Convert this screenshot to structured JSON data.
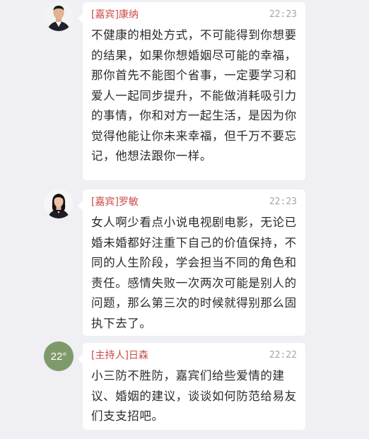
{
  "messages": [
    {
      "sender": "[嘉宾]康纳",
      "time": "22:23",
      "avatar": "male-guest-photo",
      "text": "不健康的相处方式，不可能得到你想要的结果，如果你想婚姻尽可能的幸福，那你首先不能图个省事，一定要学习和爱人一起同步提升，不能做消耗吸引力的事情，你和对方一起生活，是因为你觉得他能让你未来幸福，但千万不要忘记，他想法跟你一样。"
    },
    {
      "sender": "[嘉宾]罗敏",
      "time": "22:23",
      "avatar": "female-guest-photo",
      "text": "女人啊少看点小说电视剧电影，无论已婚未婚都好注重下自己的价值保持，不同的人生阶段，学会担当不同的角色和责任。感情失败一次两次可能是别人的问题，那么第三次的时候就得别那么固执下去了。"
    },
    {
      "sender": "[主持人]日森",
      "time": "22:22",
      "avatar_text": "22°",
      "text": "小三防不胜防，嘉宾们给些爱情的建议、婚姻的建议，谈谈如何防范给易友们支支招吧。"
    }
  ],
  "colors": {
    "background": "#efeff4",
    "bubble": "#ffffff",
    "sender_name": "#cc4a4a",
    "time": "#a6a6a6",
    "text": "#2b2b2b",
    "host_avatar": "#7f9a6a"
  }
}
